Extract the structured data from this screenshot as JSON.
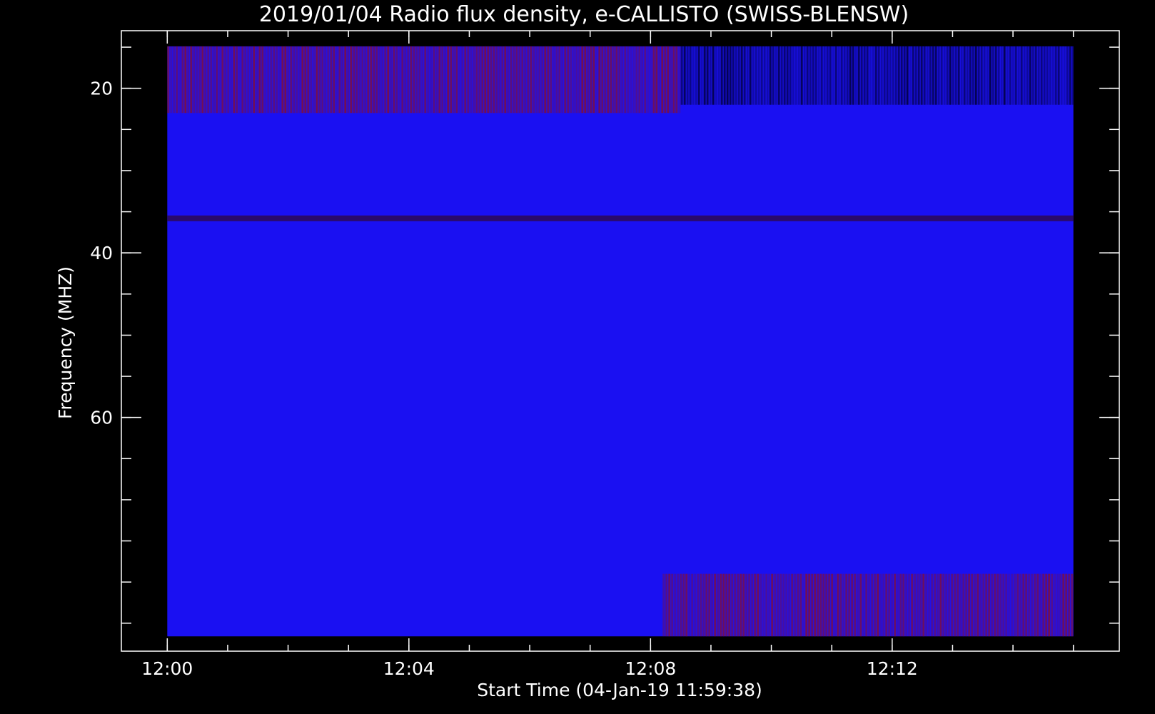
{
  "chart_data": {
    "type": "heatmap",
    "title": "2019/01/04  Radio flux density, e-CALLISTO (SWISS-BLENSW)",
    "xlabel": "Start Time (04-Jan-19 11:59:38)",
    "ylabel": "Frequency (MHZ)",
    "x_ticks": [
      {
        "label": "12:00",
        "minutes": 0
      },
      {
        "label": "12:04",
        "minutes": 4
      },
      {
        "label": "12:08",
        "minutes": 8
      },
      {
        "label": "12:12",
        "minutes": 12
      }
    ],
    "x_minor_step_minutes": 1,
    "xlim_minutes": [
      -0.76,
      15.76
    ],
    "data_x_range_minutes": [
      0,
      15.0
    ],
    "y_ticks": [
      {
        "label": "20",
        "value": 20
      },
      {
        "label": "40",
        "value": 40
      },
      {
        "label": "60",
        "value": 60
      }
    ],
    "y_minor_step": 5,
    "ylim": [
      88.4,
      13.0
    ],
    "data_y_range_mhz": [
      14.9,
      86.6
    ],
    "y_axis_inverted": true,
    "colors": {
      "background": "#000000",
      "axis": "#ffffff",
      "low": "#00002a",
      "mid": "#1a10f2",
      "high": "#8a0f2a"
    },
    "features": [
      {
        "description_value": "elevated flux",
        "freq_range_mhz": [
          14.9,
          23.0
        ],
        "time_range_minutes": [
          0,
          8.5
        ],
        "level": "high"
      },
      {
        "description_value": "dark low flux",
        "freq_range_mhz": [
          14.9,
          22.0
        ],
        "time_range_minutes": [
          8.5,
          15.0
        ],
        "level": "low"
      },
      {
        "description_value": "band line",
        "freq_mhz": 35.8,
        "time_range_minutes": [
          0,
          15.0
        ]
      },
      {
        "description_value": "elevated flux",
        "freq_range_mhz": [
          79.0,
          86.6
        ],
        "time_range_minutes": [
          8.2,
          15.0
        ],
        "level": "high"
      }
    ]
  }
}
